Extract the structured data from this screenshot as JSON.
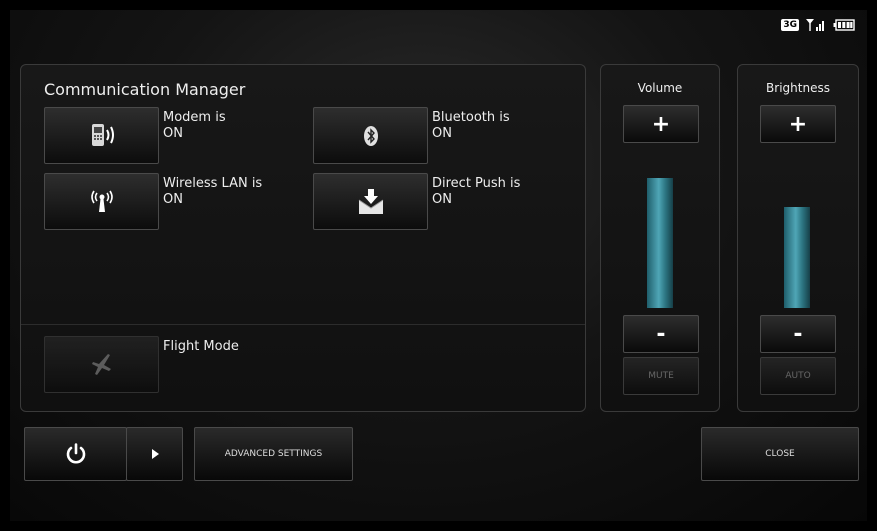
{
  "status_bar": {
    "network_label": "3G",
    "signal_icon": "signal-icon",
    "battery_icon": "battery-icon"
  },
  "comm": {
    "title": "Communication Manager",
    "toggles": [
      {
        "id": "modem",
        "label": "Modem is\nON",
        "icon": "phone-signal-icon"
      },
      {
        "id": "bluetooth",
        "label": "Bluetooth is\nON",
        "icon": "bluetooth-icon"
      },
      {
        "id": "wlan",
        "label": "Wireless LAN is\nON",
        "icon": "antenna-icon"
      },
      {
        "id": "push",
        "label": "Direct Push is\nON",
        "icon": "envelope-download-icon"
      }
    ],
    "flight": {
      "label": "Flight Mode",
      "icon": "airplane-icon"
    }
  },
  "volume": {
    "title": "Volume",
    "plus": "+",
    "minus": "-",
    "extra": "MUTE",
    "level": 0.98
  },
  "brightness": {
    "title": "Brightness",
    "plus": "+",
    "minus": "-",
    "extra": "AUTO",
    "level": 0.76
  },
  "bottom": {
    "power_icon": "power-icon",
    "arrow_icon": "play-arrow-icon",
    "advanced": "ADVANCED SETTINGS",
    "close": "CLOSE"
  },
  "colors": {
    "bar": "#4fa6b6",
    "background": "#000000"
  }
}
